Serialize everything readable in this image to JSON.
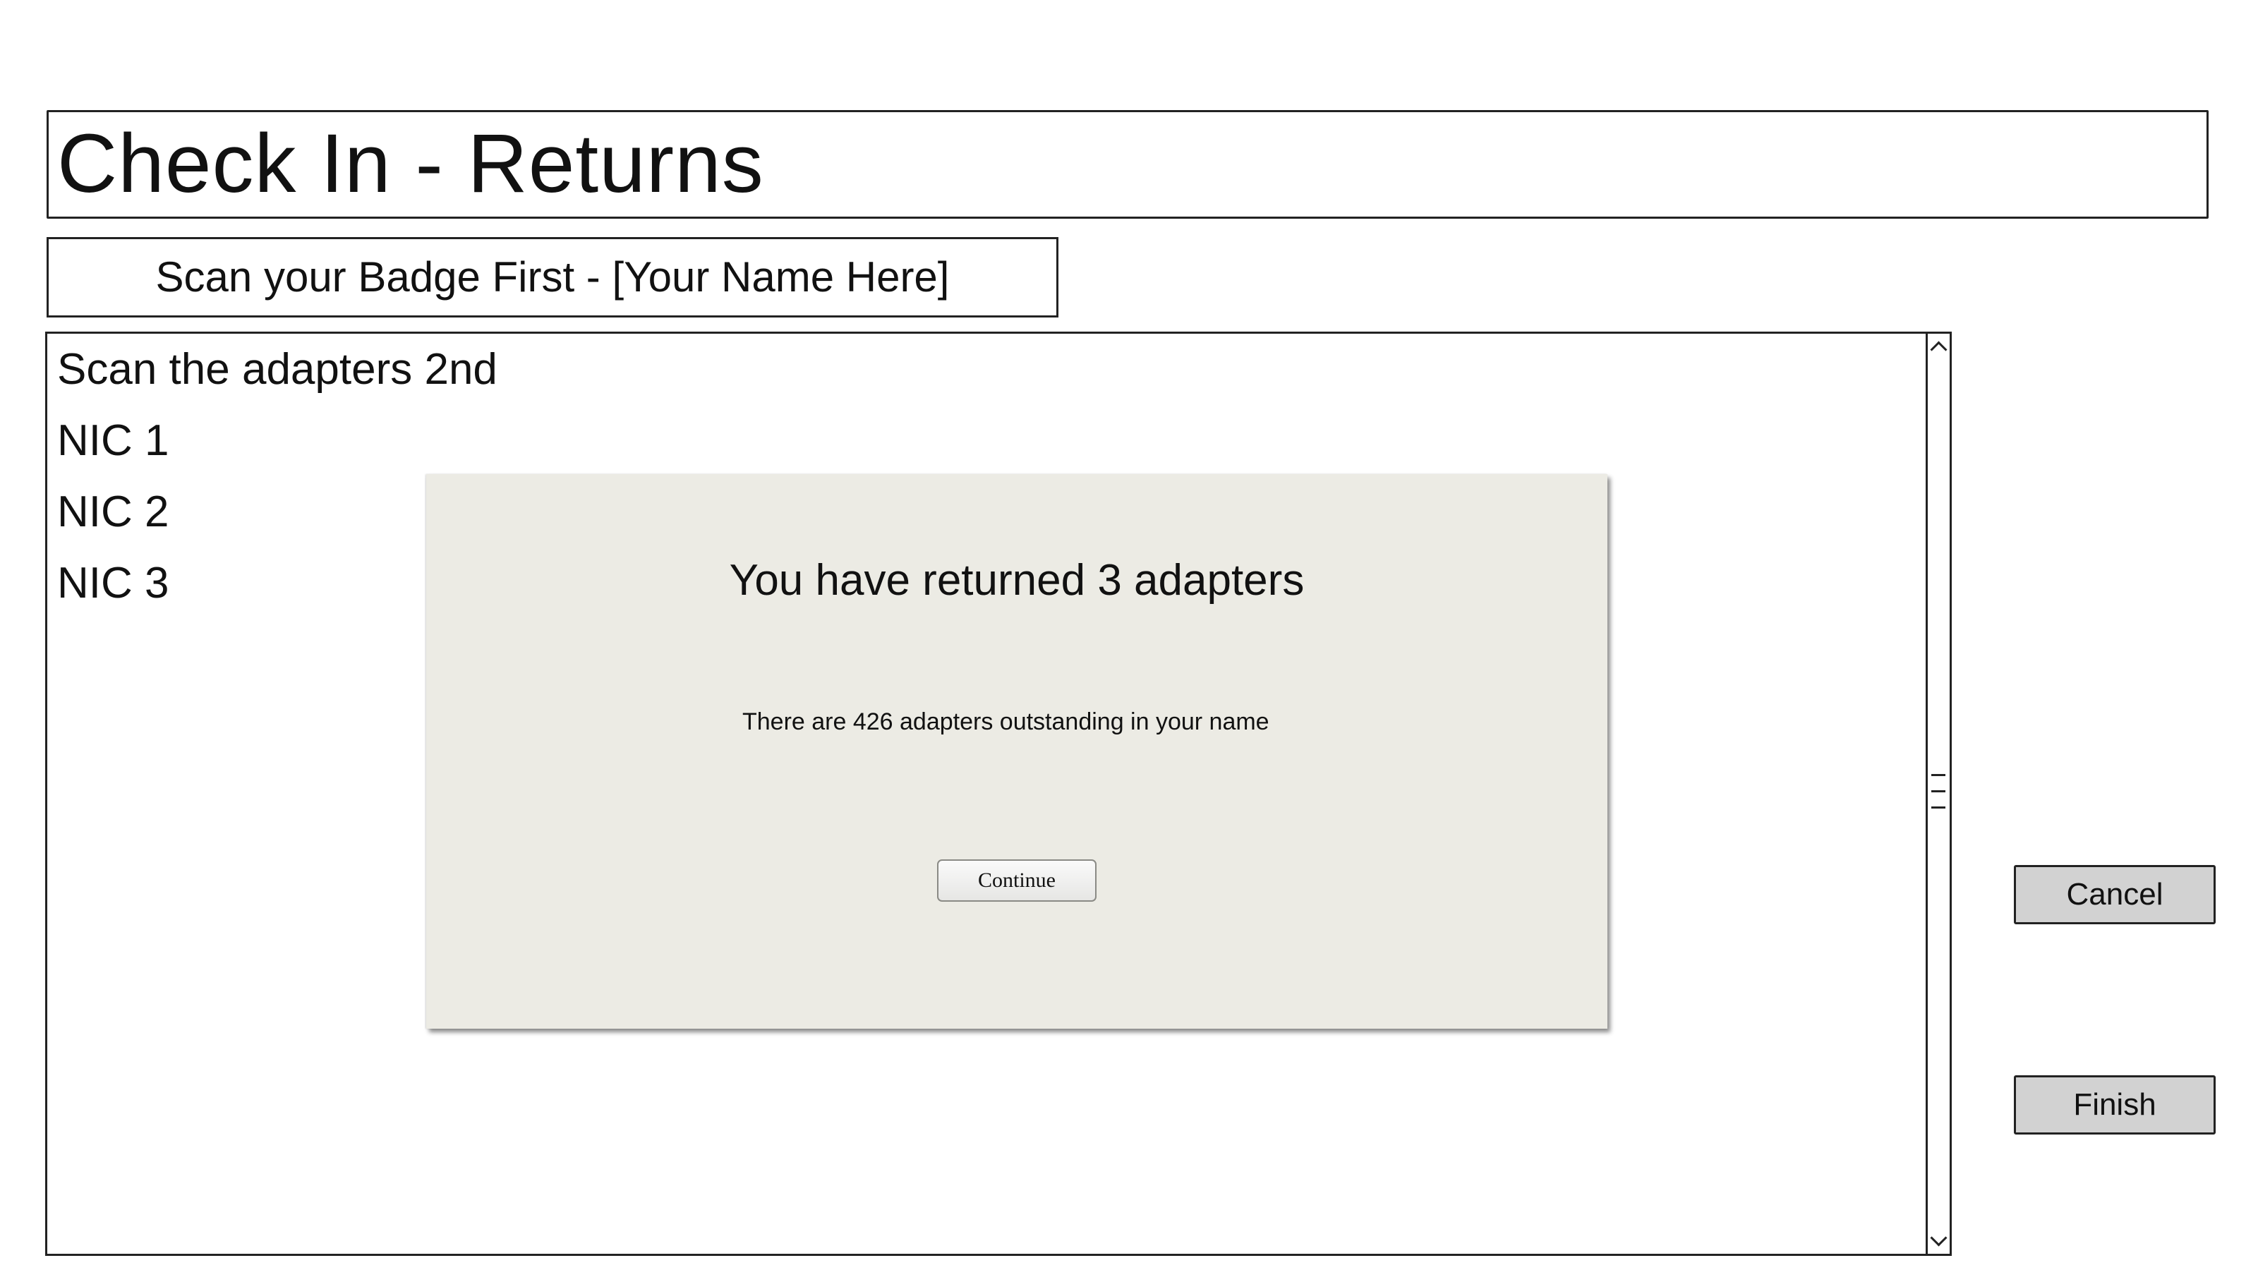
{
  "header": {
    "title": "Check In - Returns"
  },
  "badge": {
    "prompt": "Scan your Badge First - [Your Name Here]"
  },
  "adapter_list": {
    "items": [
      "Scan the adapters 2nd",
      "NIC 1",
      "NIC 2",
      "NIC 3"
    ]
  },
  "dialog": {
    "title": "You have returned 3 adapters",
    "message": "There are 426 adapters outstanding in your name",
    "continue_label": "Continue"
  },
  "actions": {
    "cancel_label": "Cancel",
    "finish_label": "Finish"
  },
  "icons": {
    "scroll_up": "chevron-up-icon",
    "scroll_down": "chevron-down-icon",
    "scroll_grip": "grip-icon"
  }
}
